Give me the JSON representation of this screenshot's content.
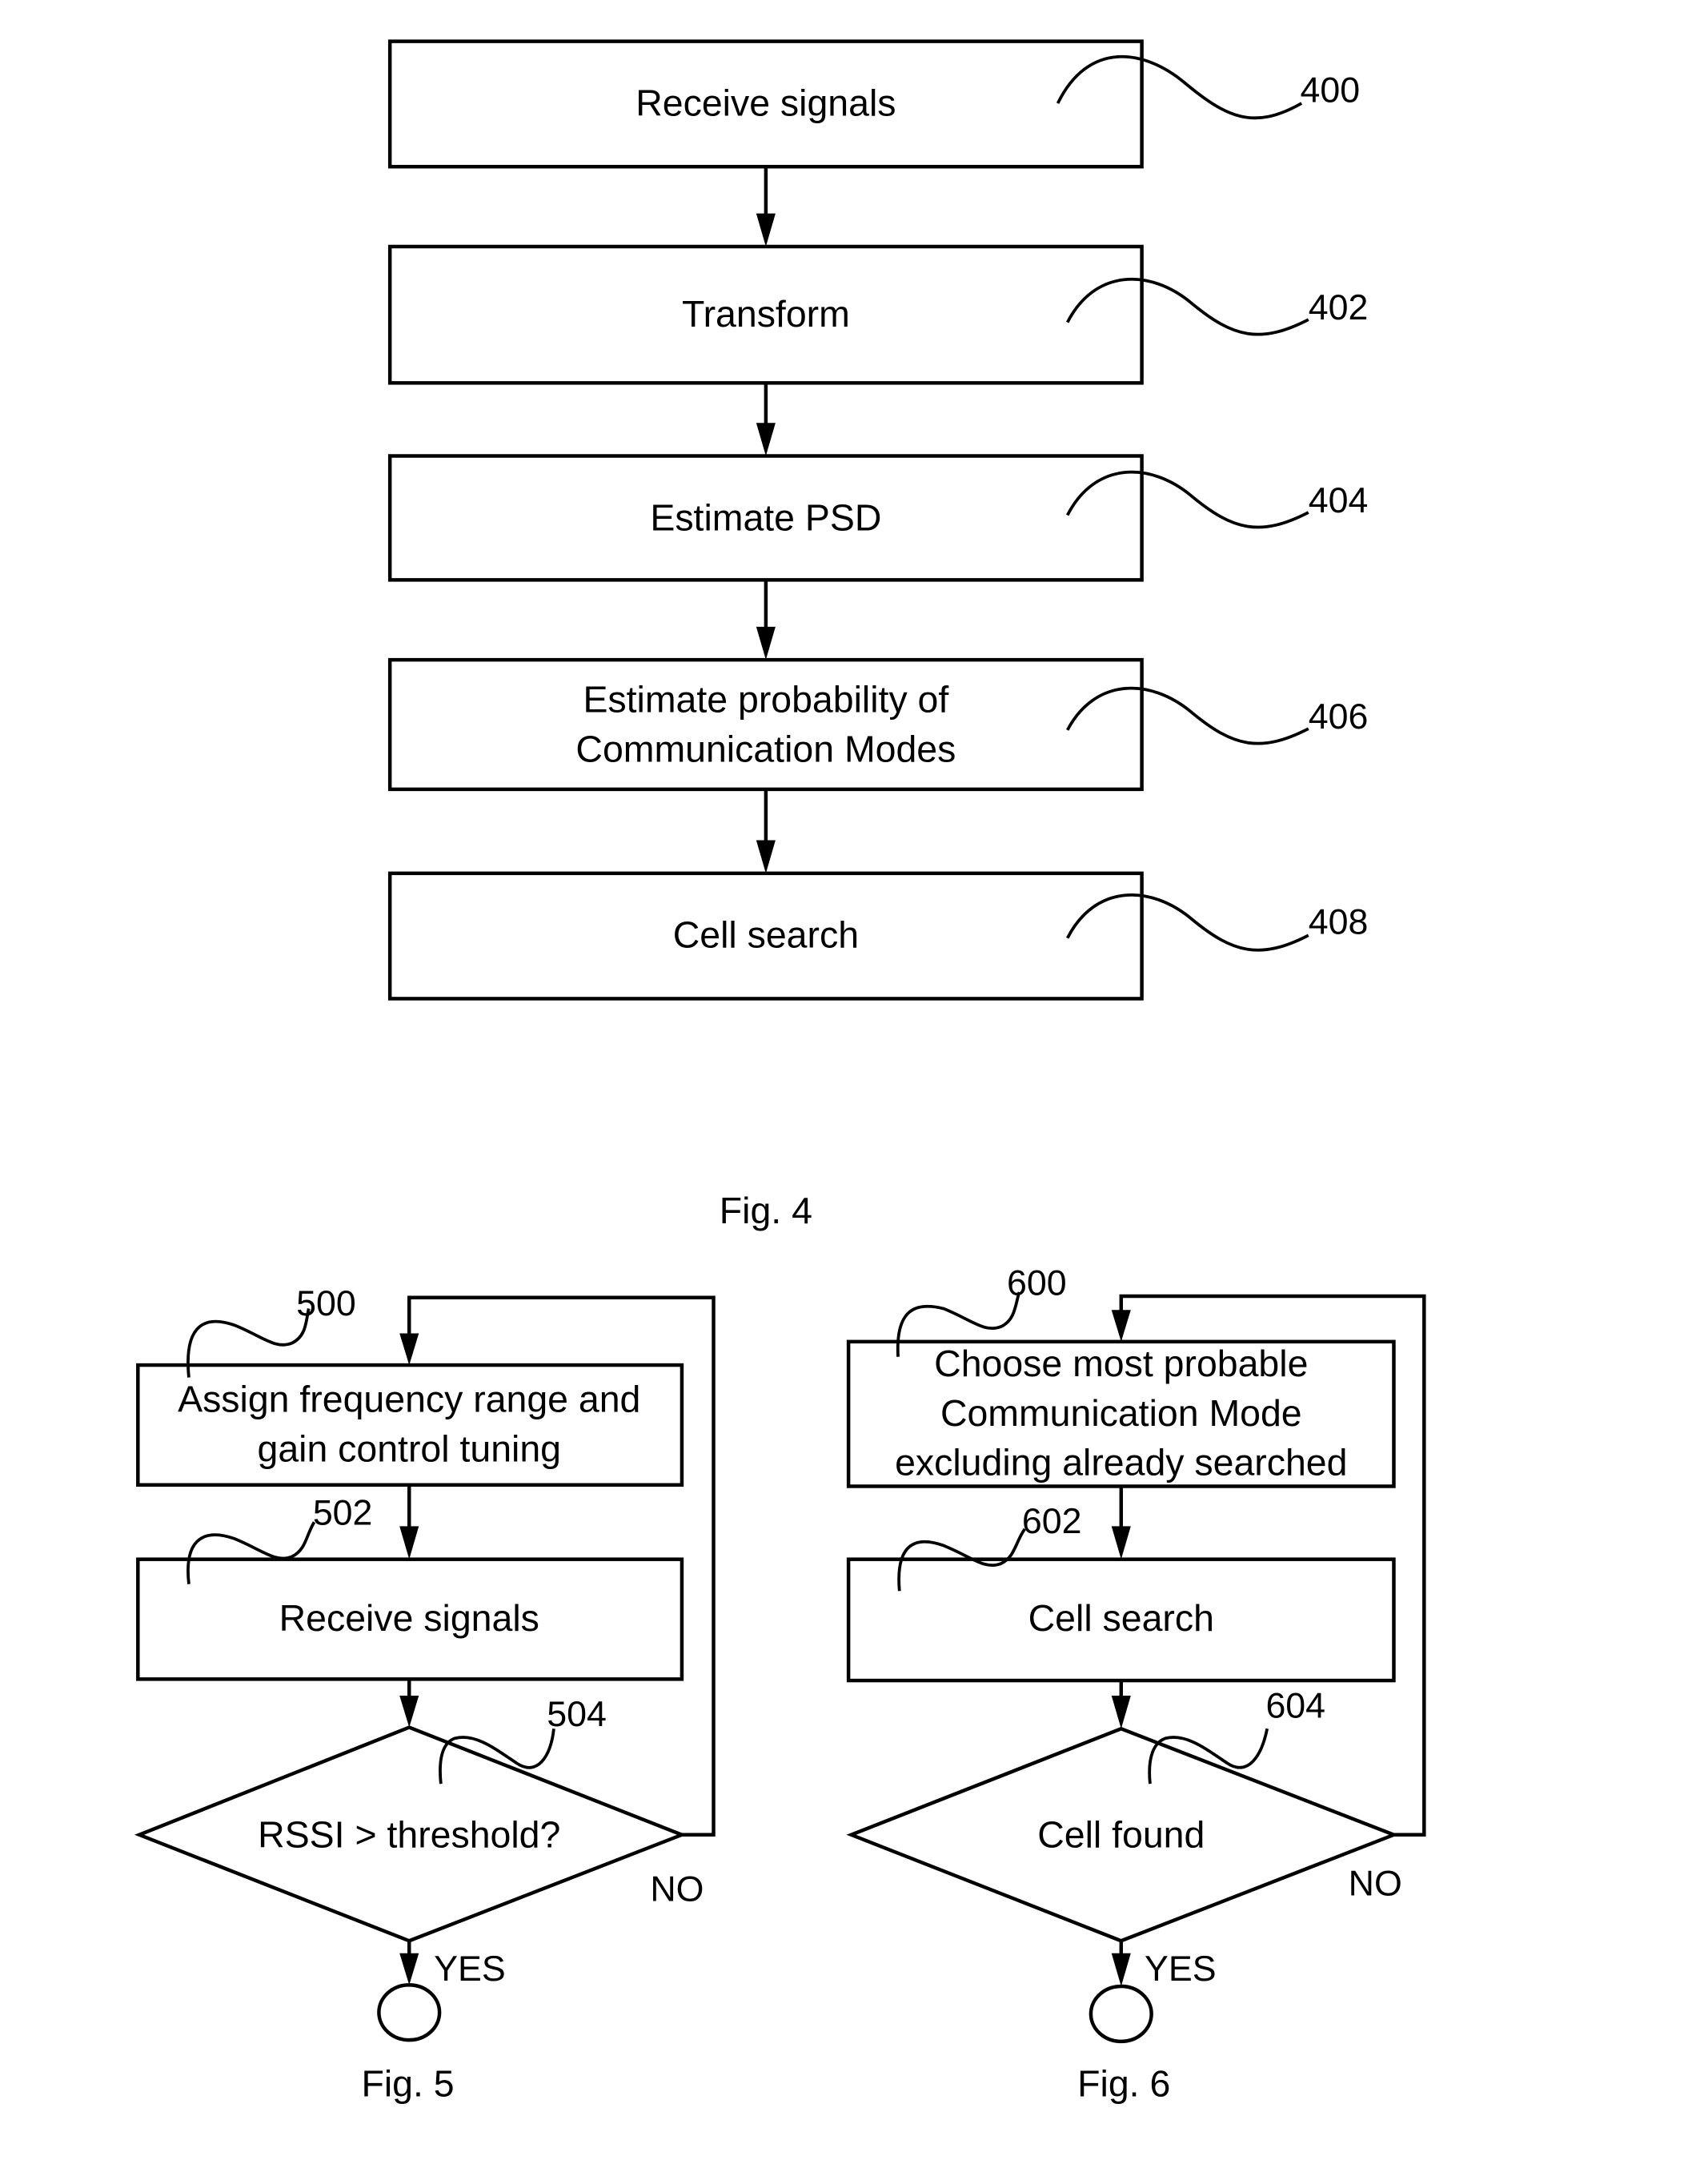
{
  "fig4": {
    "caption": "Fig. 4",
    "steps": [
      {
        "ref": "400",
        "lines": [
          "Receive signals"
        ]
      },
      {
        "ref": "402",
        "lines": [
          "Transform"
        ]
      },
      {
        "ref": "404",
        "lines": [
          "Estimate PSD"
        ]
      },
      {
        "ref": "406",
        "lines": [
          "Estimate probability of",
          "Communication Modes"
        ]
      },
      {
        "ref": "408",
        "lines": [
          "Cell search"
        ]
      }
    ]
  },
  "fig5": {
    "caption": "Fig. 5",
    "steps": [
      {
        "ref": "500",
        "lines": [
          "Assign frequency range and",
          "gain control tuning"
        ]
      },
      {
        "ref": "502",
        "lines": [
          "Receive signals"
        ]
      }
    ],
    "decision": {
      "ref": "504",
      "text": "RSSI > threshold?",
      "yes": "YES",
      "no": "NO"
    }
  },
  "fig6": {
    "caption": "Fig. 6",
    "steps": [
      {
        "ref": "600",
        "lines": [
          "Choose most probable",
          "Communication Mode",
          "excluding already searched"
        ]
      },
      {
        "ref": "602",
        "lines": [
          "Cell search"
        ]
      }
    ],
    "decision": {
      "ref": "604",
      "text": "Cell found",
      "yes": "YES",
      "no": "NO"
    }
  }
}
